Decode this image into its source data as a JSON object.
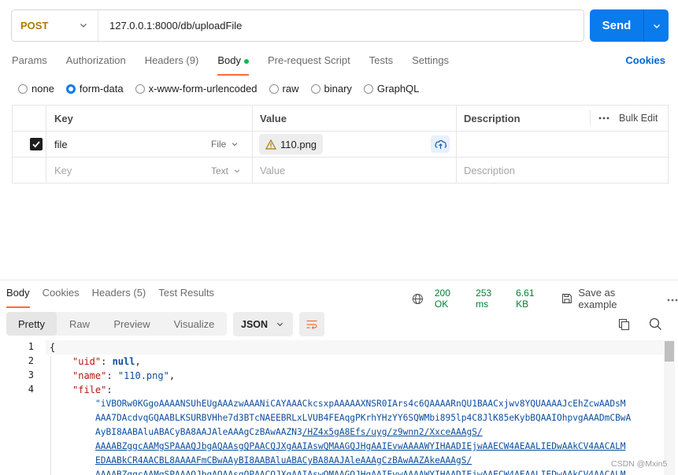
{
  "request": {
    "method": "POST",
    "url": "127.0.0.1:8000/db/uploadFile",
    "send_label": "Send"
  },
  "req_tabs": [
    {
      "label": "Params"
    },
    {
      "label": "Authorization"
    },
    {
      "label": "Headers (9)"
    },
    {
      "label": "Body"
    },
    {
      "label": "Pre-request Script"
    },
    {
      "label": "Tests"
    },
    {
      "label": "Settings"
    }
  ],
  "cookies_label": "Cookies",
  "body_types": [
    {
      "label": "none"
    },
    {
      "label": "form-data"
    },
    {
      "label": "x-www-form-urlencoded"
    },
    {
      "label": "raw"
    },
    {
      "label": "binary"
    },
    {
      "label": "GraphQL"
    }
  ],
  "params": {
    "headers": {
      "key": "Key",
      "value": "Value",
      "description": "Description",
      "bulk": "Bulk Edit"
    },
    "row": {
      "key": "file",
      "type": "File",
      "file_name": "110.png"
    },
    "empty": {
      "key": "Key",
      "type": "Text",
      "value": "Value",
      "description": "Description"
    }
  },
  "resp_tabs": [
    {
      "label": "Body"
    },
    {
      "label": "Cookies"
    },
    {
      "label": "Headers (5)"
    },
    {
      "label": "Test Results"
    }
  ],
  "resp_meta": {
    "status": "200 OK",
    "time": "253 ms",
    "size": "6.61 KB",
    "save": "Save as example"
  },
  "view_modes": [
    {
      "label": "Pretty"
    },
    {
      "label": "Raw"
    },
    {
      "label": "Preview"
    },
    {
      "label": "Visualize"
    }
  ],
  "format": "JSON",
  "code": {
    "line_numbers": [
      "1",
      "2",
      "3",
      "4"
    ],
    "l1": "{",
    "uid_key": "\"uid\"",
    "uid_val": "null",
    "name_key": "\"name\"",
    "name_val": "\"110.png\"",
    "file_key": "\"file\"",
    "b64": [
      "\"iVBORw0KGgoAAAANSUhEUgAAAzwAAANiCAYAAACkcsxpAAAAAXNSR0IArs4c6QAAAARnQU1BAACxjwv8YQUAAAAJcEhZcwAADsM",
      "AAA7DAcdvqGQAABLKSURBVHhe7d3BTcNAEEBRLxLVUB4FEAqgPKrhYHzYY6SQWMbi895lp4C8JlK85eKybBQAAIOhpvgAAADmCBwA",
      "AyBI8AABAluABACyBA8AAJAleAAAgCzBAwAAZN3",
      "AAAABZggcAAMgSPAAAQJbgAQAAsgQPAACQJXgAAIAswQMAAGQJHgAAIEvwAAAAWYIHAADIEjwAAECW4AEAALIEDwAAkCV4AACALM",
      "EDAABkCR4AACBL8AAAAFmCBwAAyBI8AABAluABACyBA8AAJAleAAAgCzBAwAAZAkeAAAgS/",
      "AAAABZggcAAMgSPAAAQJbgAQAAsgQPAACQJXgAAIAswQMAAGQJHgAAIEvwAAAAWYIHAADIEjwAAECW4AEAALIEDwAAkCV4AACALM"
    ],
    "b64_tail": "/HZ4x5gA8Efs/uyg/z9wnn2/XxceAAAgS/"
  },
  "watermark": "CSDN @Mxin5"
}
